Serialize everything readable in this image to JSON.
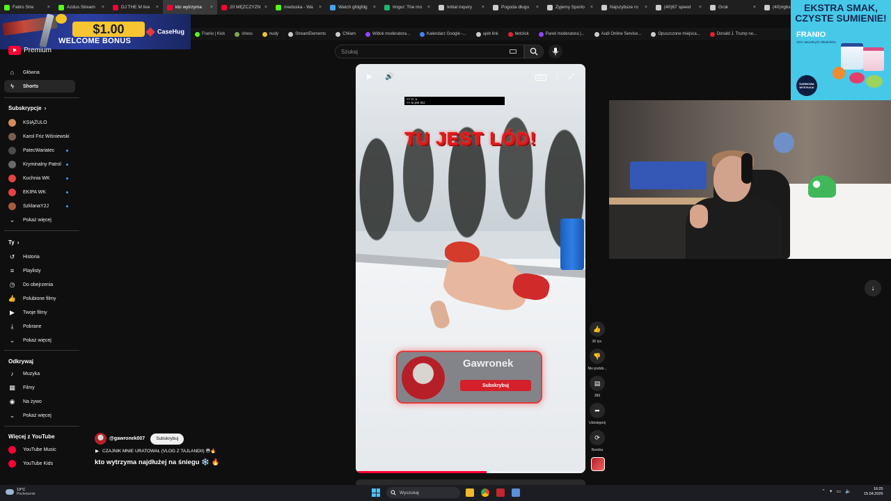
{
  "browser": {
    "tabs": [
      {
        "label": "Fatiro Stre",
        "color": "#53fc18"
      },
      {
        "label": "Azdus Stream",
        "color": "#53fc18"
      },
      {
        "label": "DJ THE M live",
        "color": "#ff0033"
      },
      {
        "label": "kto wytrzyma",
        "color": "#ff0033",
        "active": true
      },
      {
        "label": "20 MĘŻCZYZN",
        "color": "#ff0033"
      },
      {
        "label": "meduska - Wa",
        "color": "#53fc18"
      },
      {
        "label": "Watch gfdgfdg",
        "color": "#3ea6ff"
      },
      {
        "label": "Imgur: The mo",
        "color": "#1bb76e"
      },
      {
        "label": "Initial inquiry",
        "color": "#cccccc"
      },
      {
        "label": "Pogoda długo",
        "color": "#cccccc"
      },
      {
        "label": "Żyjemy Sporto",
        "color": "#cccccc"
      },
      {
        "label": "Najszybsze ro",
        "color": "#cccccc"
      },
      {
        "label": "(40)67 speed",
        "color": "#cccccc"
      },
      {
        "label": "Grok",
        "color": "#cccccc"
      },
      {
        "label": "(40)#gbs",
        "color": "#cccccc"
      }
    ],
    "bookmarks": [
      {
        "label": "Franio | Kick",
        "color": "#53fc18"
      },
      {
        "label": "chess",
        "color": "#7fa650"
      },
      {
        "label": "nudy",
        "color": "#e8c13a"
      },
      {
        "label": "StreamElements",
        "color": "#cccccc"
      },
      {
        "label": "Chilam",
        "color": "#cccccc"
      },
      {
        "label": "Widok moderatora...",
        "color": "#9146ff"
      },
      {
        "label": "Kalendarz Google -...",
        "color": "#4285f4"
      },
      {
        "label": "ujeb link",
        "color": "#cccccc"
      },
      {
        "label": "betclick",
        "color": "#e1242a"
      },
      {
        "label": "Panel moderatora |...",
        "color": "#9146ff"
      },
      {
        "label": "Audi Online Service...",
        "color": "#cccccc"
      },
      {
        "label": "Opuszczone miejsca...",
        "color": "#cccccc"
      },
      {
        "label": "Donald J. Trump ne...",
        "color": "#e1242a"
      }
    ]
  },
  "ad_left": {
    "amount": "$1.00",
    "bonus": "WELCOME BONUS",
    "brand": "CaseHug"
  },
  "ad_right": {
    "headline": "EKSTRA SMAK, CZYSTE SUMIENIE!",
    "brand": "FRANIO",
    "tagline": "10% naturalnych składników",
    "badge": "DARMOWA WYSYŁKA!"
  },
  "logo": {
    "text": "Premium"
  },
  "search": {
    "placeholder": "Szukaj"
  },
  "sidebar": {
    "main": [
      {
        "label": "Główna",
        "icon": "home-icon",
        "glyph": "⌂"
      },
      {
        "label": "Shorts",
        "icon": "shorts-icon",
        "glyph": "ϟ",
        "active": true
      }
    ],
    "subs_header": "Subskrypcje",
    "subs": [
      {
        "label": "KSIĄŻULO",
        "color": "#d58c5a",
        "live": false
      },
      {
        "label": "Karol Friz Wiśniewski",
        "color": "#7a5f4e",
        "live": false
      },
      {
        "label": "PatecWariatec",
        "color": "#4b4b4b",
        "live": true
      },
      {
        "label": "Kryminalny Patrol",
        "color": "#6a6a6a",
        "live": true
      },
      {
        "label": "Kuchnia WK",
        "color": "#e6423f",
        "live": true
      },
      {
        "label": "EKIPA WK",
        "color": "#e6423f",
        "live": true
      },
      {
        "label": "SzklanaY2J",
        "color": "#a85b3c",
        "live": true
      }
    ],
    "subs_more": "Pokaż więcej",
    "you_header": "Ty",
    "you": [
      {
        "label": "Historia",
        "icon": "history-icon",
        "glyph": "↺"
      },
      {
        "label": "Playlisty",
        "icon": "playlists-icon",
        "glyph": "≡"
      },
      {
        "label": "Do obejrzenia",
        "icon": "watch-later-icon",
        "glyph": "◷"
      },
      {
        "label": "Polubione filmy",
        "icon": "liked-icon",
        "glyph": "👍"
      },
      {
        "label": "Twoje filmy",
        "icon": "your-videos-icon",
        "glyph": "▶"
      },
      {
        "label": "Pobrane",
        "icon": "download-icon",
        "glyph": "⤓"
      }
    ],
    "you_more": "Pokaż więcej",
    "explore_header": "Odkrywaj",
    "explore": [
      {
        "label": "Muzyka",
        "icon": "music-icon",
        "glyph": "♪"
      },
      {
        "label": "Filmy",
        "icon": "movies-icon",
        "glyph": "▦"
      },
      {
        "label": "Na żywo",
        "icon": "live-icon",
        "glyph": "◉"
      }
    ],
    "explore_more": "Pokaż więcej",
    "more_header": "Więcej z YouTube",
    "more": [
      {
        "label": "YouTube Music",
        "color": "#ff0033"
      },
      {
        "label": "YouTube Kids",
        "color": "#ff0033"
      }
    ]
  },
  "video": {
    "caption_line1": ">> O, o.",
    "caption_line2": ">> tu jest lód.",
    "overlay_title": "TU JEST LÓD!",
    "sub_card_name": "Gawronek",
    "sub_card_button": "Subskrybuj",
    "progress": 0.57
  },
  "actions": {
    "likes": "36 tys.",
    "dislike": "Nie podob...",
    "comments": "389",
    "share": "Udostępnij",
    "remix": "Remiks"
  },
  "channel": {
    "handle": "@gawronek007",
    "subscribe": "Subskrybuj",
    "playlist": "CZAJNIK MNIE URATOWAŁ (VLOG Z TAJLANDII) 😳🔥",
    "title": "kto wytrzyma najdłużej na śniegu ❄️ 🔥"
  },
  "taskbar": {
    "temp": "13°C",
    "condition": "Pochmurnie",
    "search": "Wyszukaj",
    "time": "16:25",
    "date": "15.04.2026"
  }
}
